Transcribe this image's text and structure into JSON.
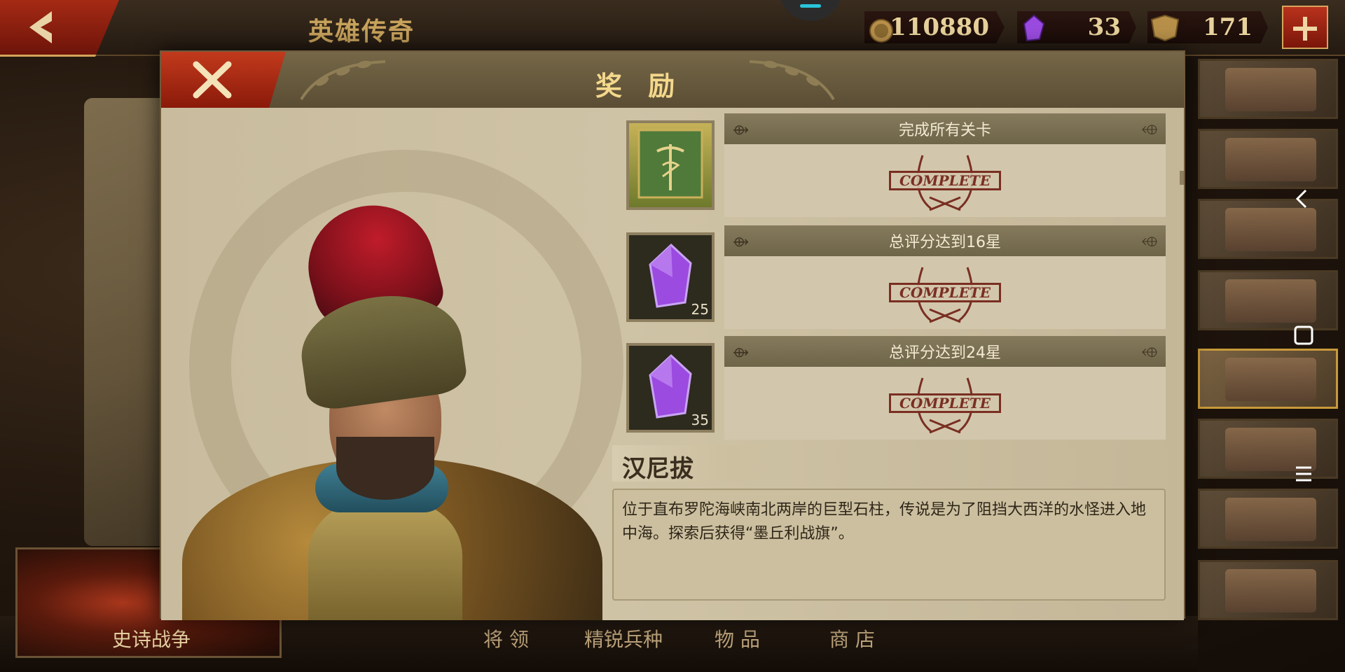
{
  "topbar": {
    "title": "英雄传奇",
    "resources": [
      {
        "name": "coin",
        "icon": "coin-icon",
        "value": "110880"
      },
      {
        "name": "gem",
        "icon": "gem-icon",
        "value": "33"
      },
      {
        "name": "spqr",
        "icon": "spqr-medal-icon",
        "value": "171"
      }
    ]
  },
  "modal": {
    "title": "奖 励",
    "rewards": [
      {
        "label": "完成所有关卡",
        "icon": "mercury-flag-icon",
        "count": "",
        "stamp": "COMPLETE"
      },
      {
        "label": "总评分达到16星",
        "icon": "gem-icon",
        "count": "25",
        "stamp": "COMPLETE"
      },
      {
        "label": "总评分达到24星",
        "icon": "gem-icon",
        "count": "35",
        "stamp": "COMPLETE"
      }
    ],
    "hero_name": "汉尼拔",
    "description": "位于直布罗陀海峡南北两岸的巨型石柱，传说是为了阻挡大西洋的水怪进入地中海。探索后获得“墨丘利战旗”。"
  },
  "bottom_nav": {
    "epic": "史诗战争",
    "items": [
      "将 领",
      "精锐兵种",
      "物 品",
      "商 店"
    ]
  },
  "colors": {
    "accent_red": "#a52a14",
    "gold": "#c8a35c",
    "stamp_red": "#7a2e22"
  }
}
